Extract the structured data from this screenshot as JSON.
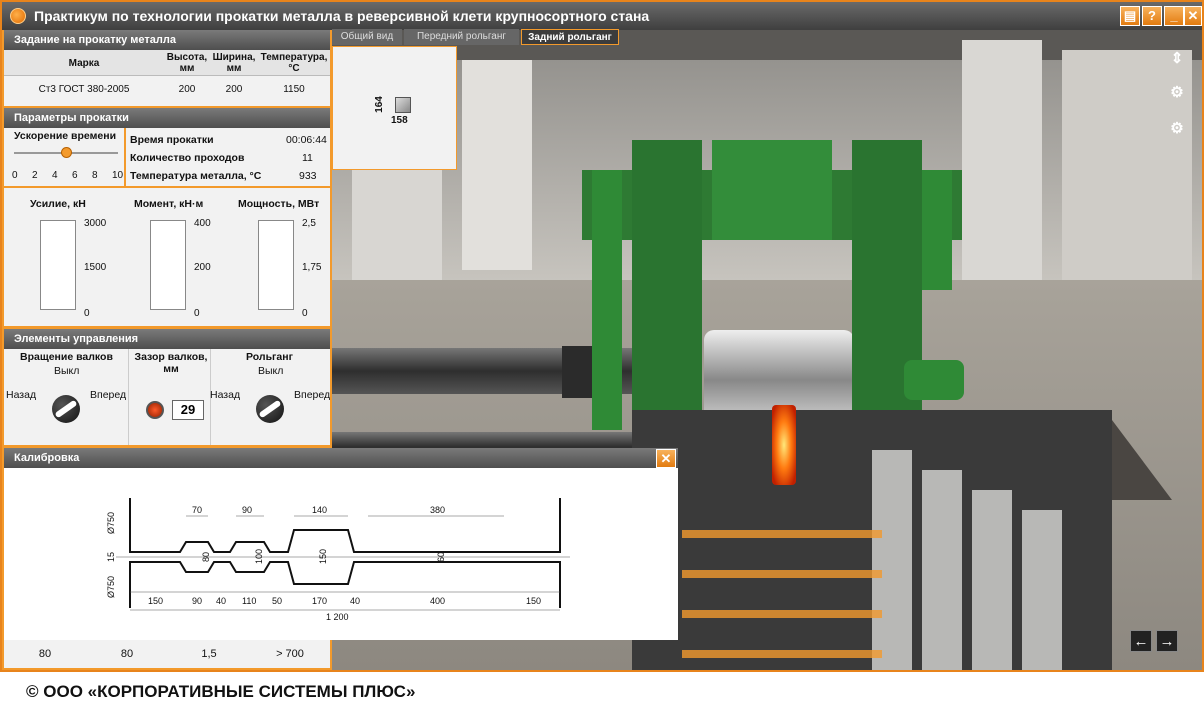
{
  "window": {
    "title": "Практикум по технологии прокатки металла в реверсивной клети крупносортного стана",
    "buttons": [
      "?",
      "_",
      "✕"
    ]
  },
  "task": {
    "header": "Задание на прокатку металла",
    "columns": [
      "Марка",
      "Высота, мм",
      "Ширина, мм",
      "Температура, °С"
    ],
    "row": [
      "Ст3 ГОСТ 380-2005",
      "200",
      "200",
      "1150"
    ]
  },
  "params": {
    "header": "Параметры прокатки",
    "time_accel_label": "Ускорение времени",
    "time_accel_ticks": [
      "0",
      "2",
      "4",
      "6",
      "8",
      "10"
    ],
    "time_accel_value": 0.5,
    "rows": [
      {
        "label": "Время прокатки",
        "value": "00:06:44"
      },
      {
        "label": "Количество проходов",
        "value": "11"
      },
      {
        "label": "Температура металла, °С",
        "value": "933"
      }
    ]
  },
  "gauges": [
    {
      "label": "Усилие, кН",
      "max": "3000",
      "mid": "1500",
      "min": "0"
    },
    {
      "label": "Момент, кН·м",
      "max": "400",
      "mid": "200",
      "min": "0"
    },
    {
      "label": "Мощность, МВт",
      "max": "2,5",
      "mid": "1,75",
      "min": "0"
    }
  ],
  "controls": {
    "header": "Элементы управления",
    "rotation": {
      "label": "Вращение валков",
      "state": "Выкл",
      "left": "Назад",
      "right": "Вперед"
    },
    "gap": {
      "label": "Зазор валков, мм",
      "value": "29"
    },
    "roller": {
      "label": "Рольганг",
      "state": "Выкл",
      "left": "Назад",
      "right": "Вперед"
    }
  },
  "tabs": [
    "Общий вид",
    "Передний рольганг",
    "Задний рольганг"
  ],
  "preview": {
    "height": "164",
    "width": "158"
  },
  "calibration": {
    "header": "Калибровка",
    "top_dims": [
      "70",
      "90",
      "140",
      "380"
    ],
    "bottom_dims": [
      "150",
      "90",
      "40",
      "110",
      "50",
      "170",
      "40",
      "400",
      "150"
    ],
    "total": "1 200",
    "vertical_labels": [
      "Ø750",
      "15",
      "Ø750",
      "80",
      "100",
      "150",
      "60"
    ],
    "footer": [
      "80",
      "80",
      "1,5",
      "> 700"
    ]
  },
  "copyright": "© ООО «КОРПОРАТИВНЫЕ СИСТЕМЫ ПЛЮС»"
}
